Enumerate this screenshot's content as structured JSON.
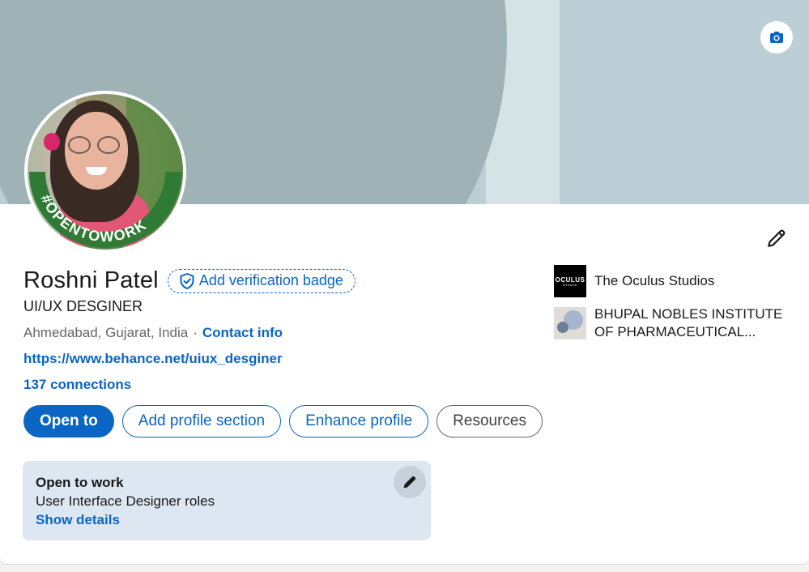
{
  "profile": {
    "name": "Roshni Patel",
    "verification_badge_label": "Add verification badge",
    "headline": "UI/UX DESGINER",
    "location": "Ahmedabad, Gujarat, India",
    "separator": "·",
    "contact_info_label": "Contact info",
    "website": "https://www.behance.net/uiux_desginer",
    "connections": "137 connections",
    "avatar_frame_text": "#OPENTOWORK"
  },
  "actions": {
    "open_to": "Open to",
    "add_profile_section": "Add profile section",
    "enhance_profile": "Enhance profile",
    "resources": "Resources"
  },
  "experience": [
    {
      "label": "The Oculus Studios",
      "logo_text": "OCULUS",
      "logo_subtext": "STUDIO"
    },
    {
      "label": "BHUPAL NOBLES INSTITUTE OF PHARMACEUTICAL..."
    }
  ],
  "open_to_work": {
    "title": "Open to work",
    "roles": "User Interface Designer roles",
    "show_details": "Show details"
  },
  "icons": {
    "banner_camera": "camera-icon",
    "edit_intro": "pencil-icon",
    "verify": "shield-check-icon",
    "otw_edit": "pencil-icon"
  },
  "colors": {
    "accent": "#0a66c2",
    "banner_left": "#9fb3b7",
    "banner_right": "#bccfd6",
    "otw_bg": "#dde7f1",
    "otw_ring": "#2f7a35"
  }
}
